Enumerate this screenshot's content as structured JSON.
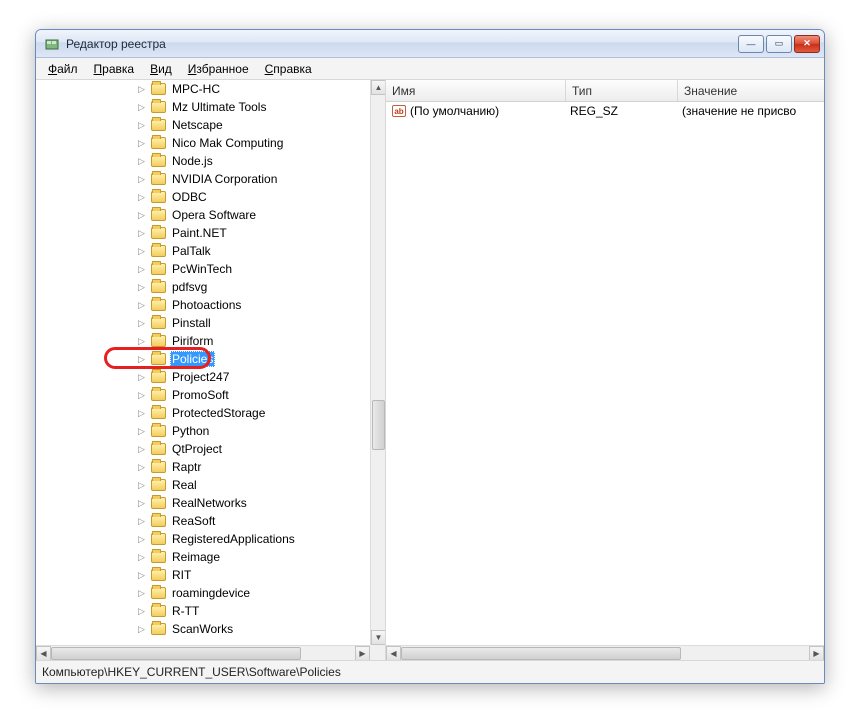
{
  "window": {
    "title": "Редактор реестра"
  },
  "menu": {
    "file": {
      "u": "Ф",
      "rest": "айл"
    },
    "edit": {
      "u": "П",
      "rest": "равка"
    },
    "view": {
      "u": "В",
      "rest": "ид"
    },
    "fav": {
      "u": "И",
      "rest": "збранное"
    },
    "help": {
      "u": "С",
      "rest": "правка"
    }
  },
  "tree": {
    "items": [
      "MPC-HC",
      "Mz Ultimate Tools",
      "Netscape",
      "Nico Mak Computing",
      "Node.js",
      "NVIDIA Corporation",
      "ODBC",
      "Opera Software",
      "Paint.NET",
      "PalTalk",
      "PcWinTech",
      "pdfsvg",
      "Photoactions",
      "Pinstall",
      "Piriform",
      "Policies",
      "Project247",
      "PromoSoft",
      "ProtectedStorage",
      "Python",
      "QtProject",
      "Raptr",
      "Real",
      "RealNetworks",
      "ReaSoft",
      "RegisteredApplications",
      "Reimage",
      "RIT",
      "roamingdevice",
      "R-TT",
      "ScanWorks"
    ],
    "selected_index": 15
  },
  "list": {
    "columns": {
      "name": "Имя",
      "type": "Тип",
      "value": "Значение"
    },
    "rows": [
      {
        "name": "(По умолчанию)",
        "type": "REG_SZ",
        "value": "(значение не присво"
      }
    ]
  },
  "statusbar": {
    "path": "Компьютер\\HKEY_CURRENT_USER\\Software\\Policies"
  }
}
